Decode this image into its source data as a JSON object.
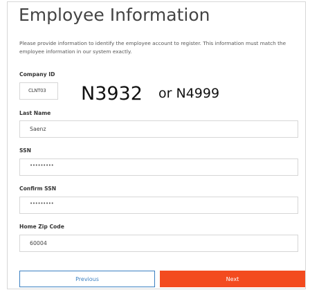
{
  "page": {
    "title": "Employee Information",
    "description": "Please provide information to identify the employee account to register. This information must match the employee information in our system exactly."
  },
  "fields": {
    "company_id": {
      "label": "Company ID",
      "value": "CLNT03"
    },
    "last_name": {
      "label": "Last Name",
      "value": "Saenz"
    },
    "ssn": {
      "label": "SSN",
      "value": "•••••••••"
    },
    "confirm_ssn": {
      "label": "Confirm SSN",
      "value": "•••••••••"
    },
    "home_zip": {
      "label": "Home Zip Code",
      "value": "60004"
    }
  },
  "handwritten_annotation": {
    "primary": "N3932",
    "secondary": "or N4999"
  },
  "buttons": {
    "previous": "Previous",
    "next": "Next"
  },
  "colors": {
    "next_button": "#f34b1f",
    "previous_border": "#3a7fc1"
  }
}
